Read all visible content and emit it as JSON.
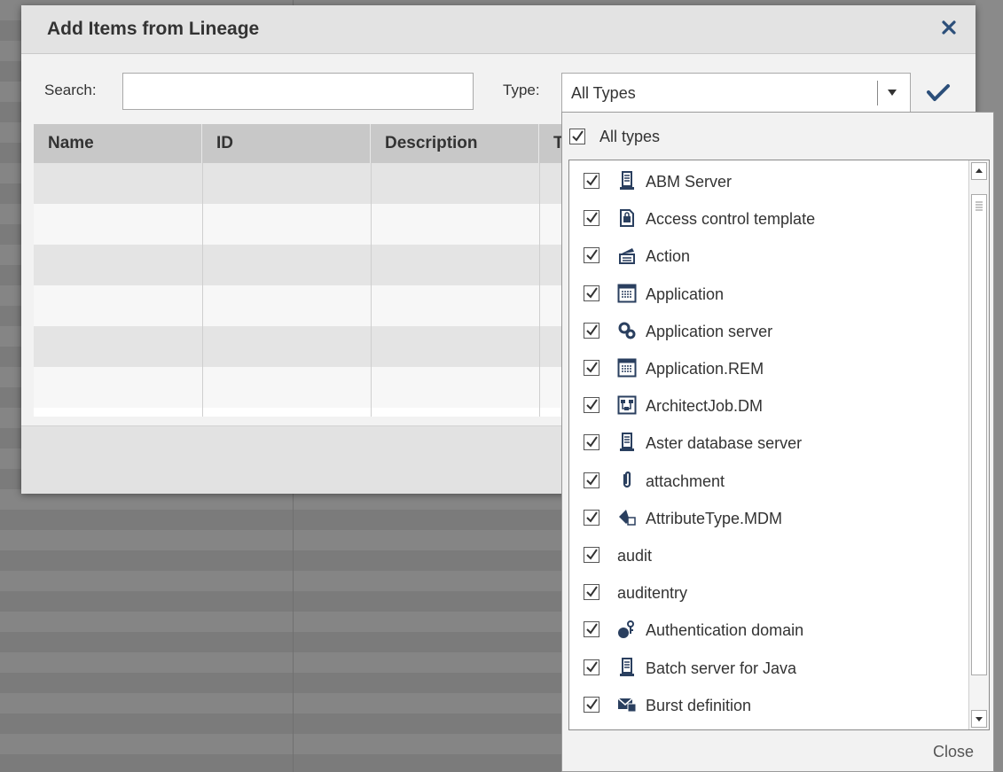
{
  "dialog": {
    "title": "Add Items from Lineage",
    "search_label": "Search:",
    "search_value": "",
    "type_label": "Type:",
    "type_value": "All Types"
  },
  "grid": {
    "columns": [
      "Name",
      "ID",
      "Description",
      "T"
    ]
  },
  "dropdown": {
    "all_label": "All types",
    "all_checked": true,
    "items": [
      {
        "label": "ABM Server",
        "icon": "server-icon",
        "checked": true
      },
      {
        "label": "Access control template",
        "icon": "access-template-icon",
        "checked": true
      },
      {
        "label": "Action",
        "icon": "action-icon",
        "checked": true
      },
      {
        "label": "Application",
        "icon": "application-icon",
        "checked": true
      },
      {
        "label": "Application server",
        "icon": "gears-icon",
        "checked": true
      },
      {
        "label": "Application.REM",
        "icon": "application-icon",
        "checked": true
      },
      {
        "label": "ArchitectJob.DM",
        "icon": "architect-job-icon",
        "checked": true
      },
      {
        "label": "Aster database server",
        "icon": "server-icon",
        "checked": true
      },
      {
        "label": "attachment",
        "icon": "paperclip-icon",
        "checked": true
      },
      {
        "label": "AttributeType.MDM",
        "icon": "attribute-type-icon",
        "checked": true
      },
      {
        "label": "audit",
        "icon": "",
        "checked": true
      },
      {
        "label": "auditentry",
        "icon": "",
        "checked": true
      },
      {
        "label": "Authentication domain",
        "icon": "authentication-domain-icon",
        "checked": true
      },
      {
        "label": "Batch server for Java",
        "icon": "server-icon",
        "checked": true
      },
      {
        "label": "Burst definition",
        "icon": "burst-definition-icon",
        "checked": true
      }
    ],
    "close_label": "Close"
  }
}
